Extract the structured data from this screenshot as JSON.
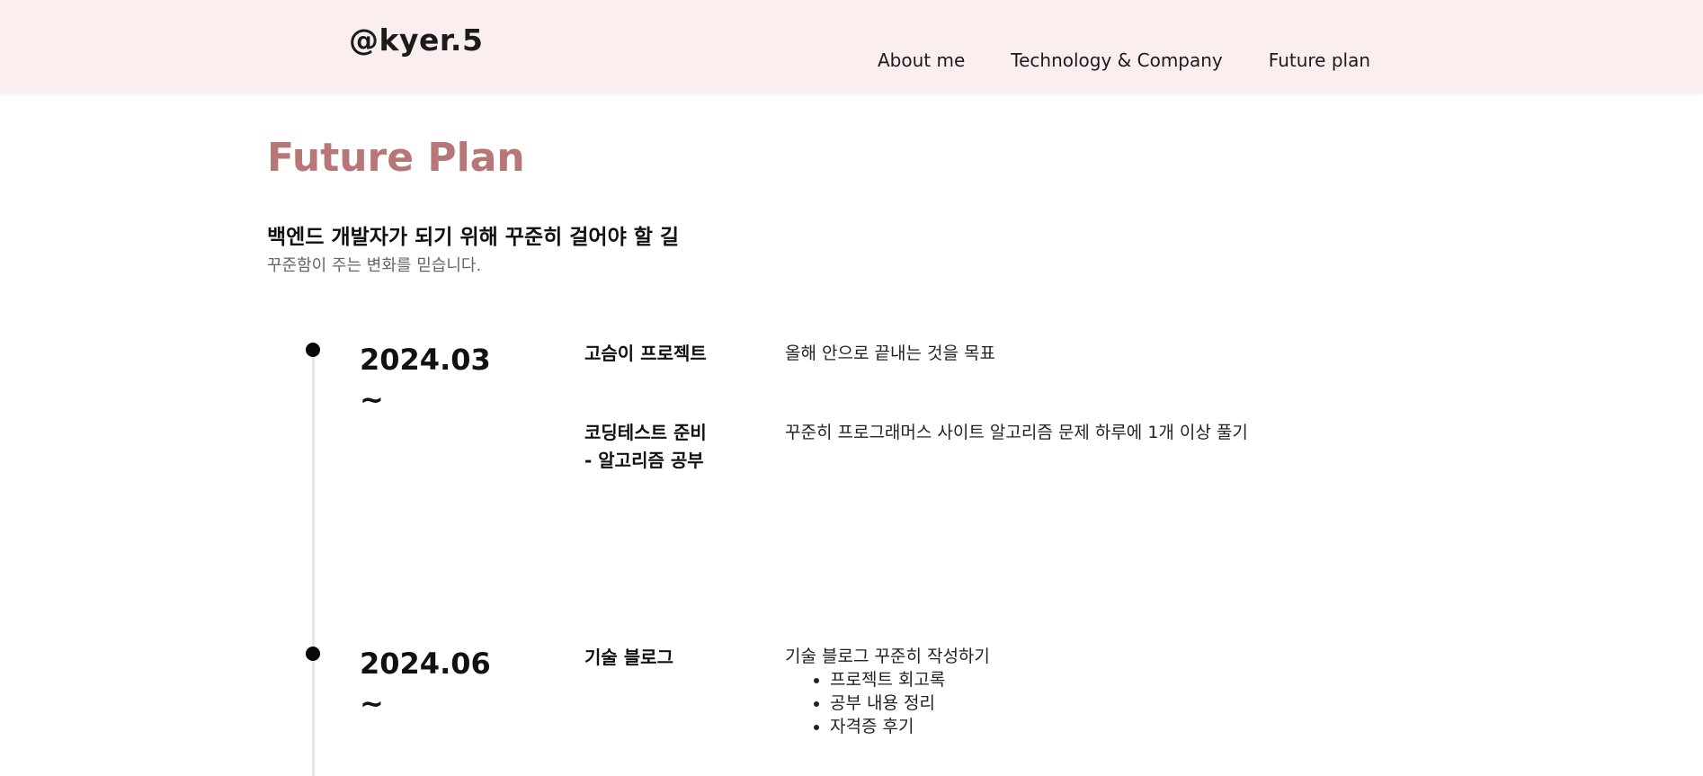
{
  "header": {
    "brand": "@kyer.5",
    "nav": [
      {
        "label": "About me"
      },
      {
        "label": "Technology & Company"
      },
      {
        "label": "Future plan"
      }
    ]
  },
  "main": {
    "title": "Future Plan",
    "subtitle": "백엔드 개발자가 되기 위해 꾸준히 걸어야 할 길",
    "tagline": "꾸준함이 주는 변화를 믿습니다.",
    "timeline": [
      {
        "date_line1": "2024.03",
        "date_line2": "~",
        "items": [
          {
            "title": "고슴이 프로젝트",
            "desc": "올해 안으로 끝내는 것을 목표"
          },
          {
            "title_line1": "코딩테스트 준비",
            "title_line2": "- 알고리즘 공부",
            "desc": "꾸준히 프로그래머스 사이트 알고리즘 문제 하루에 1개 이상 풀기"
          }
        ]
      },
      {
        "date_line1": "2024.06",
        "date_line2": "~",
        "items": [
          {
            "title": "기술 블로그",
            "desc": "기술 블로그 꾸준히 작성하기",
            "bullets": [
              "프로젝트 회고록",
              "공부 내용 정리",
              "자격증 후기"
            ]
          }
        ]
      }
    ]
  }
}
